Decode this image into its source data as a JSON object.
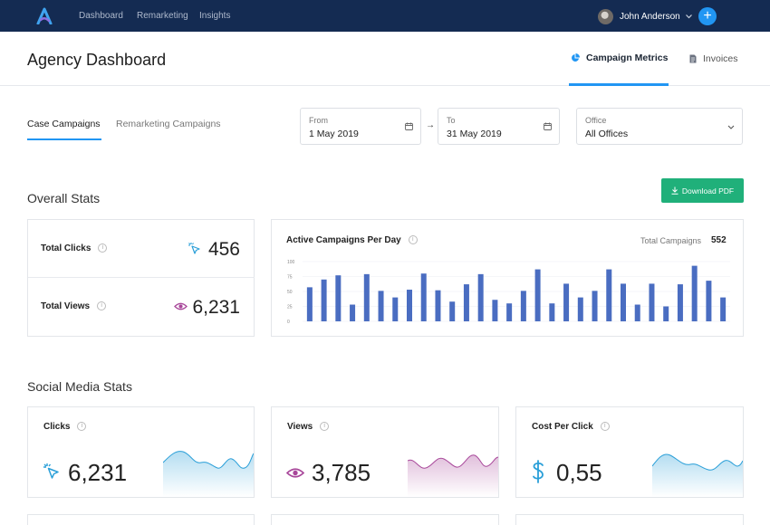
{
  "nav": {
    "items": [
      "Dashboard",
      "Remarketing",
      "Insights"
    ],
    "user_name": "John Anderson",
    "add_symbol": "+"
  },
  "header": {
    "title": "Agency Dashboard",
    "tabs": [
      {
        "label": "Campaign Metrics",
        "active": true,
        "icon": "pie-chart-icon"
      },
      {
        "label": "Invoices",
        "active": false,
        "icon": "document-icon"
      }
    ]
  },
  "sub_tabs": [
    {
      "label": "Case Campaigns",
      "active": true
    },
    {
      "label": "Remarketing Campaigns",
      "active": false
    }
  ],
  "filters": {
    "from": {
      "label": "From",
      "value": "1 May 2019",
      "icon": "calendar-icon"
    },
    "separator": "→",
    "to": {
      "label": "To",
      "value": "31 May 2019",
      "icon": "calendar-icon"
    },
    "office": {
      "label": "Office",
      "value": "All Offices",
      "icon": "chevron-down-icon"
    }
  },
  "overall": {
    "title": "Overall Stats",
    "download_label": "Download PDF",
    "total_clicks": {
      "label": "Total Clicks",
      "value": "456",
      "icon": "cursor-click-icon"
    },
    "total_views": {
      "label": "Total Views",
      "value": "6,231",
      "icon": "eye-icon"
    }
  },
  "chart_data": {
    "type": "bar",
    "title": "Active Campaigns Per Day",
    "total_label": "Total Campaigns",
    "total_value": "552",
    "yticks": [
      "100",
      "75",
      "50",
      "25",
      "0"
    ],
    "ylim": [
      0,
      100
    ],
    "grid": true,
    "color": "#4a6dc1",
    "values": [
      57,
      70,
      77,
      28,
      79,
      51,
      40,
      53,
      80,
      52,
      33,
      62,
      79,
      36,
      30,
      51,
      87,
      30,
      63,
      40,
      51,
      87,
      63,
      28,
      63,
      25,
      62,
      93,
      68,
      40
    ]
  },
  "social": {
    "title": "Social Media Stats",
    "cards": [
      {
        "label": "Clicks",
        "value": "6,231",
        "icon": "cursor-click-icon",
        "color": "#2a9fd8"
      },
      {
        "label": "Views",
        "value": "3,785",
        "icon": "eye-icon",
        "color": "#a8479a"
      },
      {
        "label": "Cost Per Click",
        "value": "0,55",
        "icon": "dollar-icon",
        "color": "#2a9fd8"
      }
    ]
  },
  "colors": {
    "nav_bg": "#142b52",
    "accent": "#2196f3",
    "success": "#20b07a",
    "bar": "#4a6dc1"
  }
}
